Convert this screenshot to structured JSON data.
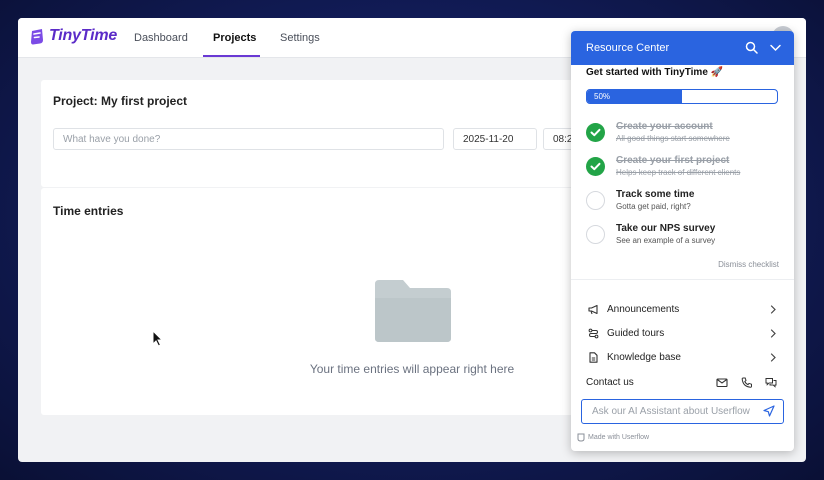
{
  "app": {
    "logo": "TinyTime",
    "brand_color": "#5b2bc8",
    "nav": [
      {
        "label": "Dashboard",
        "active": false
      },
      {
        "label": "Projects",
        "active": true
      },
      {
        "label": "Settings",
        "active": false
      }
    ]
  },
  "project": {
    "title": "Project: My first project",
    "entry_placeholder": "What have you done?",
    "date_value": "2025-11-20",
    "time_value": "08:2"
  },
  "entries": {
    "title": "Time entries",
    "empty_message": "Your time entries will appear right here"
  },
  "resource_center": {
    "title": "Resource Center",
    "accent_color": "#2a64e0",
    "checklist_title": "Get started with TinyTime 🚀",
    "progress": {
      "percent": 50,
      "label": "50%"
    },
    "tasks": [
      {
        "title": "Create your account",
        "description": "All good things start somewhere",
        "done": true
      },
      {
        "title": "Create your first project",
        "description": "Helps keep track of different clients",
        "done": true
      },
      {
        "title": "Track some time",
        "description": "Gotta get paid, right?",
        "done": false
      },
      {
        "title": "Take our NPS survey",
        "description": "See an example of a survey",
        "done": false
      }
    ],
    "dismiss_label": "Dismiss checklist",
    "menu": [
      {
        "label": "Announcements",
        "icon": "megaphone-icon"
      },
      {
        "label": "Guided tours",
        "icon": "route-icon"
      },
      {
        "label": "Knowledge base",
        "icon": "document-icon"
      }
    ],
    "contact_label": "Contact us",
    "contact_icons": [
      "mail-icon",
      "phone-icon",
      "chat-icon"
    ],
    "ask_placeholder": "Ask our AI Assistant about Userflow",
    "footer": "Made with Userflow"
  }
}
